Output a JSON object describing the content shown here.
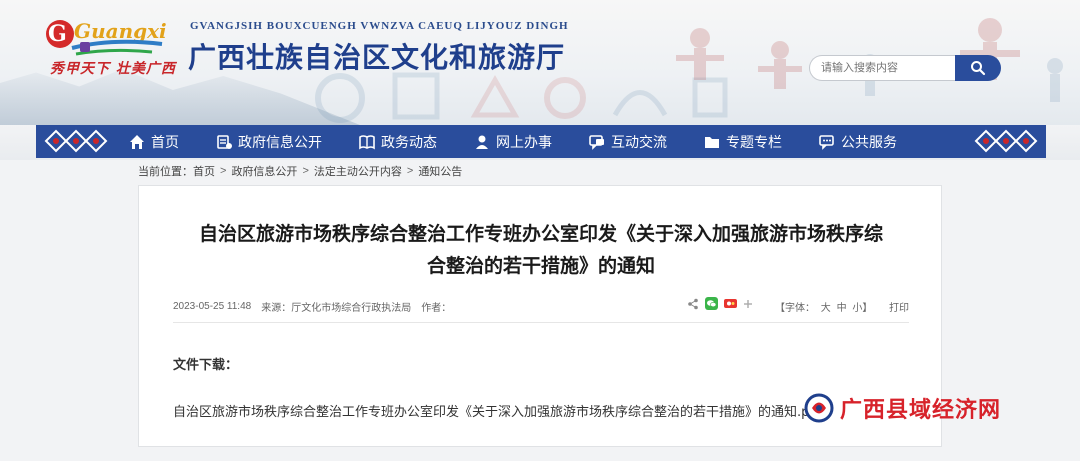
{
  "header": {
    "logo_text": "Guangxi",
    "slogan": "秀甲天下 壮美广西",
    "site_roman": "GVANGJSIH BOUXCUENGH VWNZVA CAEUQ LIJYOUZ DINGH",
    "site_title": "广西壮族自治区文化和旅游厅"
  },
  "search": {
    "placeholder": "请输入搜索内容",
    "icon": "search-icon"
  },
  "nav": {
    "items": [
      {
        "label": "首页",
        "icon": "home-icon"
      },
      {
        "label": "政府信息公开",
        "icon": "info-hand-icon"
      },
      {
        "label": "政务动态",
        "icon": "book-icon"
      },
      {
        "label": "网上办事",
        "icon": "user-icon"
      },
      {
        "label": "互动交流",
        "icon": "chat-icon"
      },
      {
        "label": "专题专栏",
        "icon": "folder-icon"
      },
      {
        "label": "公共服务",
        "icon": "service-chat-icon"
      }
    ]
  },
  "breadcrumb": {
    "prefix": "当前位置：",
    "items": [
      "首页",
      "政府信息公开",
      "法定主动公开内容",
      "通知公告"
    ],
    "separator": ">"
  },
  "article": {
    "title_line1": "自治区旅游市场秩序综合整治工作专班办公室印发《关于深入加强旅游市场秩序综",
    "title_line2": "合整治的若干措施》的通知",
    "date": "2023-05-25 11:48",
    "source": "来源：厅文化市场综合行政执法局",
    "author": "作者：",
    "font_label": "【字体：",
    "font_large": "大",
    "font_medium": "中",
    "font_small": "小】",
    "print": "打印",
    "file_label": "文件下载：",
    "file_link": "自治区旅游市场秩序综合整治工作专班办公室印发《关于深入加强旅游市场秩序综合整治的若干措施》的通知.pdf"
  },
  "watermark": {
    "text": "广西县域经济网"
  },
  "colors": {
    "nav_bg": "#2a4d9c",
    "title_blue": "#1f3f8c",
    "brand_red": "#c8262a",
    "watermark_red": "#d7222a"
  }
}
